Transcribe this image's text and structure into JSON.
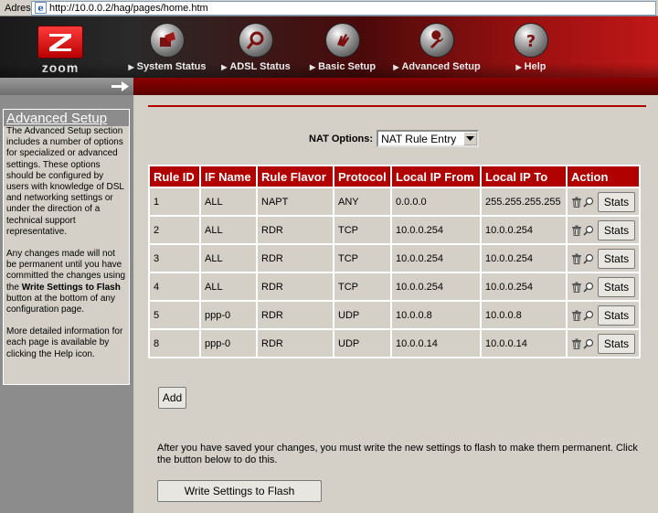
{
  "address_bar": {
    "label": "Adres",
    "url": "http://10.0.0.2/hag/pages/home.htm"
  },
  "header": {
    "logo_text": "zoom",
    "nav": [
      {
        "label": "System Status",
        "icon": "system-status-icon"
      },
      {
        "label": "ADSL Status",
        "icon": "magnifier-icon"
      },
      {
        "label": "Basic Setup",
        "icon": "hand-icon"
      },
      {
        "label": "Advanced Setup",
        "icon": "wrench-icon"
      },
      {
        "label": "Help",
        "icon": "question-icon"
      }
    ]
  },
  "sidebar": {
    "title": "Advanced Setup",
    "para1": "The Advanced Setup section includes a number of options for specialized or advanced settings. These options should be configured by users with knowledge of DSL and networking settings or under the direction of a technical support representative.",
    "para2_a": "Any changes made will not be permanent until you have committed the changes using the ",
    "para2_bold": "Write Settings to Flash",
    "para2_b": " button at the bottom of any configuration page.",
    "para3": "More detailed information for each page is available by clicking the Help icon."
  },
  "main": {
    "nat_label": "NAT Options:",
    "nat_value": "NAT Rule Entry",
    "table": {
      "headers": [
        "Rule ID",
        "IF Name",
        "Rule Flavor",
        "Protocol",
        "Local IP From",
        "Local IP To",
        "Action"
      ],
      "rows": [
        [
          "1",
          "ALL",
          "NAPT",
          "ANY",
          "0.0.0.0",
          "255.255.255.255"
        ],
        [
          "2",
          "ALL",
          "RDR",
          "TCP",
          "10.0.0.254",
          "10.0.0.254"
        ],
        [
          "3",
          "ALL",
          "RDR",
          "TCP",
          "10.0.0.254",
          "10.0.0.254"
        ],
        [
          "4",
          "ALL",
          "RDR",
          "TCP",
          "10.0.0.254",
          "10.0.0.254"
        ],
        [
          "5",
          "ppp-0",
          "RDR",
          "UDP",
          "10.0.0.8",
          "10.0.0.8"
        ],
        [
          "8",
          "ppp-0",
          "RDR",
          "UDP",
          "10.0.0.14",
          "10.0.0.14"
        ]
      ],
      "stats_label": "Stats"
    },
    "add_label": "Add",
    "note": "After you have saved your changes, you must write the new settings to flash to make them permanent. Click the button below to do this.",
    "write_label": "Write Settings to Flash"
  },
  "colors": {
    "accent_red": "#b00000",
    "sidebar_gray": "#8c8c8c",
    "page_bg": "#d4d0c8"
  }
}
